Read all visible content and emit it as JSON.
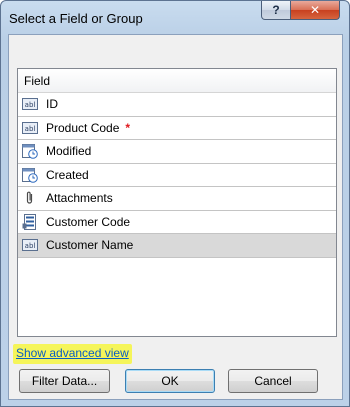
{
  "window": {
    "title": "Select a Field or Group",
    "help_glyph": "?",
    "close_glyph": "✕"
  },
  "list": {
    "column_header": "Field",
    "items": [
      {
        "label": "ID",
        "icon": "text-field-icon",
        "required": false
      },
      {
        "label": "Product Code",
        "icon": "text-field-icon",
        "required": true
      },
      {
        "label": "Modified",
        "icon": "datetime-field-icon",
        "required": false
      },
      {
        "label": "Created",
        "icon": "datetime-field-icon",
        "required": false
      },
      {
        "label": "Attachments",
        "icon": "paperclip-icon",
        "required": false
      },
      {
        "label": "Customer Code",
        "icon": "lookup-field-icon",
        "required": false
      },
      {
        "label": "Customer Name",
        "icon": "text-field-icon",
        "required": false,
        "selected": true
      }
    ],
    "required_marker": "*"
  },
  "advanced_link": "Show advanced view",
  "buttons": {
    "filter": "Filter Data...",
    "ok": "OK",
    "cancel": "Cancel"
  },
  "colors": {
    "highlight": "#f5f55a",
    "link": "#0a5ec4",
    "required": "#e0191e",
    "selected_row": "#d9d9d9"
  }
}
